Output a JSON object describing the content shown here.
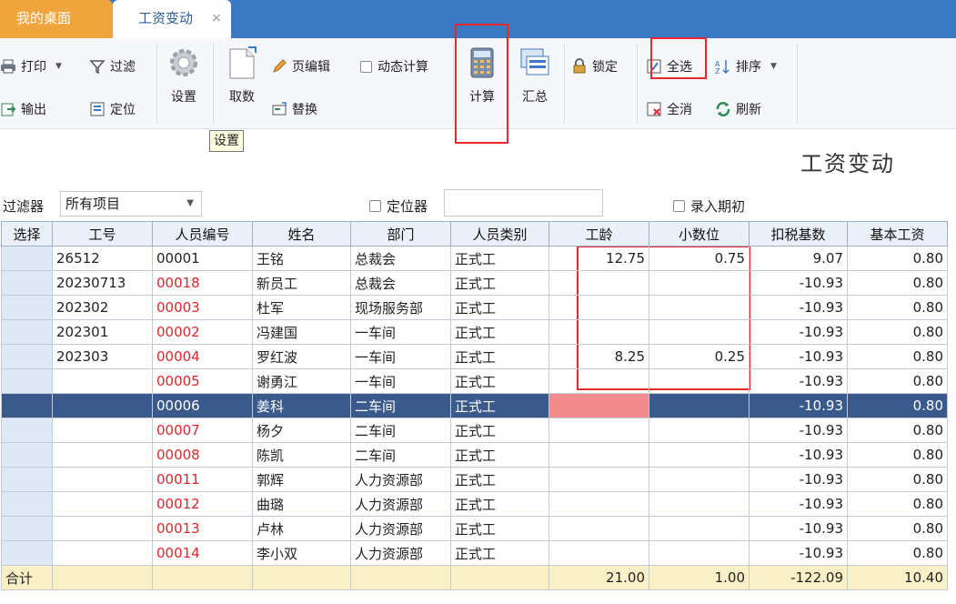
{
  "tabs": {
    "home": "我的桌面",
    "active": "工资变动",
    "close": "×"
  },
  "toolbar": {
    "print": "打印",
    "filter": "过滤",
    "export": "输出",
    "locate": "定位",
    "settings": "设置",
    "fetch": "取数",
    "page_edit": "页编辑",
    "dynamic_calc": "动态计算",
    "replace": "替换",
    "calculate": "计算",
    "summary": "汇总",
    "lock": "锁定",
    "select_all": "全选",
    "sort": "排序",
    "deselect_all": "全消",
    "refresh": "刷新"
  },
  "tooltip": "设置",
  "page_title": "工资变动",
  "filterbar": {
    "label": "过滤器",
    "selected": "所有项目",
    "locator": "定位器",
    "entry_period": "录入期初"
  },
  "table": {
    "columns": [
      "选择",
      "工号",
      "人员编号",
      "姓名",
      "部门",
      "人员类别",
      "工龄",
      "小数位",
      "扣税基数",
      "基本工资"
    ],
    "rows": [
      {
        "sel": "",
        "job_no": "26512",
        "emp_no": "00001",
        "name": "王铭",
        "dept": "总裁会",
        "cat": "正式工",
        "seniority": "12.75",
        "decimal": "0.75",
        "tax_base": "9.07",
        "base_pay": "0.80",
        "red": false
      },
      {
        "sel": "",
        "job_no": "20230713",
        "emp_no": "00018",
        "name": "新员工",
        "dept": "总裁会",
        "cat": "正式工",
        "seniority": "",
        "decimal": "",
        "tax_base": "-10.93",
        "base_pay": "0.80",
        "red": true
      },
      {
        "sel": "",
        "job_no": "202302",
        "emp_no": "00003",
        "name": "杜军",
        "dept": "现场服务部",
        "cat": "正式工",
        "seniority": "",
        "decimal": "",
        "tax_base": "-10.93",
        "base_pay": "0.80",
        "red": true
      },
      {
        "sel": "",
        "job_no": "202301",
        "emp_no": "00002",
        "name": "冯建国",
        "dept": "一车间",
        "cat": "正式工",
        "seniority": "",
        "decimal": "",
        "tax_base": "-10.93",
        "base_pay": "0.80",
        "red": true
      },
      {
        "sel": "",
        "job_no": "202303",
        "emp_no": "00004",
        "name": "罗红波",
        "dept": "一车间",
        "cat": "正式工",
        "seniority": "8.25",
        "decimal": "0.25",
        "tax_base": "-10.93",
        "base_pay": "0.80",
        "red": true
      },
      {
        "sel": "",
        "job_no": "",
        "emp_no": "00005",
        "name": "谢勇江",
        "dept": "一车间",
        "cat": "正式工",
        "seniority": "",
        "decimal": "",
        "tax_base": "-10.93",
        "base_pay": "0.80",
        "red": true
      },
      {
        "sel": "",
        "job_no": "",
        "emp_no": "00006",
        "name": "姜科",
        "dept": "二车间",
        "cat": "正式工",
        "seniority": "",
        "decimal": "",
        "tax_base": "-10.93",
        "base_pay": "0.80",
        "red": true,
        "selected": true
      },
      {
        "sel": "",
        "job_no": "",
        "emp_no": "00007",
        "name": "杨夕",
        "dept": "二车间",
        "cat": "正式工",
        "seniority": "",
        "decimal": "",
        "tax_base": "-10.93",
        "base_pay": "0.80",
        "red": true
      },
      {
        "sel": "",
        "job_no": "",
        "emp_no": "00008",
        "name": "陈凯",
        "dept": "二车间",
        "cat": "正式工",
        "seniority": "",
        "decimal": "",
        "tax_base": "-10.93",
        "base_pay": "0.80",
        "red": true
      },
      {
        "sel": "",
        "job_no": "",
        "emp_no": "00011",
        "name": "郭辉",
        "dept": "人力资源部",
        "cat": "正式工",
        "seniority": "",
        "decimal": "",
        "tax_base": "-10.93",
        "base_pay": "0.80",
        "red": true
      },
      {
        "sel": "",
        "job_no": "",
        "emp_no": "00012",
        "name": "曲璐",
        "dept": "人力资源部",
        "cat": "正式工",
        "seniority": "",
        "decimal": "",
        "tax_base": "-10.93",
        "base_pay": "0.80",
        "red": true
      },
      {
        "sel": "",
        "job_no": "",
        "emp_no": "00013",
        "name": "卢林",
        "dept": "人力资源部",
        "cat": "正式工",
        "seniority": "",
        "decimal": "",
        "tax_base": "-10.93",
        "base_pay": "0.80",
        "red": true
      },
      {
        "sel": "",
        "job_no": "",
        "emp_no": "00014",
        "name": "李小双",
        "dept": "人力资源部",
        "cat": "正式工",
        "seniority": "",
        "decimal": "",
        "tax_base": "-10.93",
        "base_pay": "0.80",
        "red": true
      }
    ],
    "total": {
      "label": "合计",
      "seniority": "21.00",
      "decimal": "1.00",
      "tax_base": "-122.09",
      "base_pay": "10.40"
    }
  },
  "colors": {
    "tabbar": "#3b79c4",
    "home_tab": "#f0a53c",
    "highlight_box": "#e8282d",
    "selected_row": "#3a5a8c",
    "red_text": "#e0252b"
  }
}
